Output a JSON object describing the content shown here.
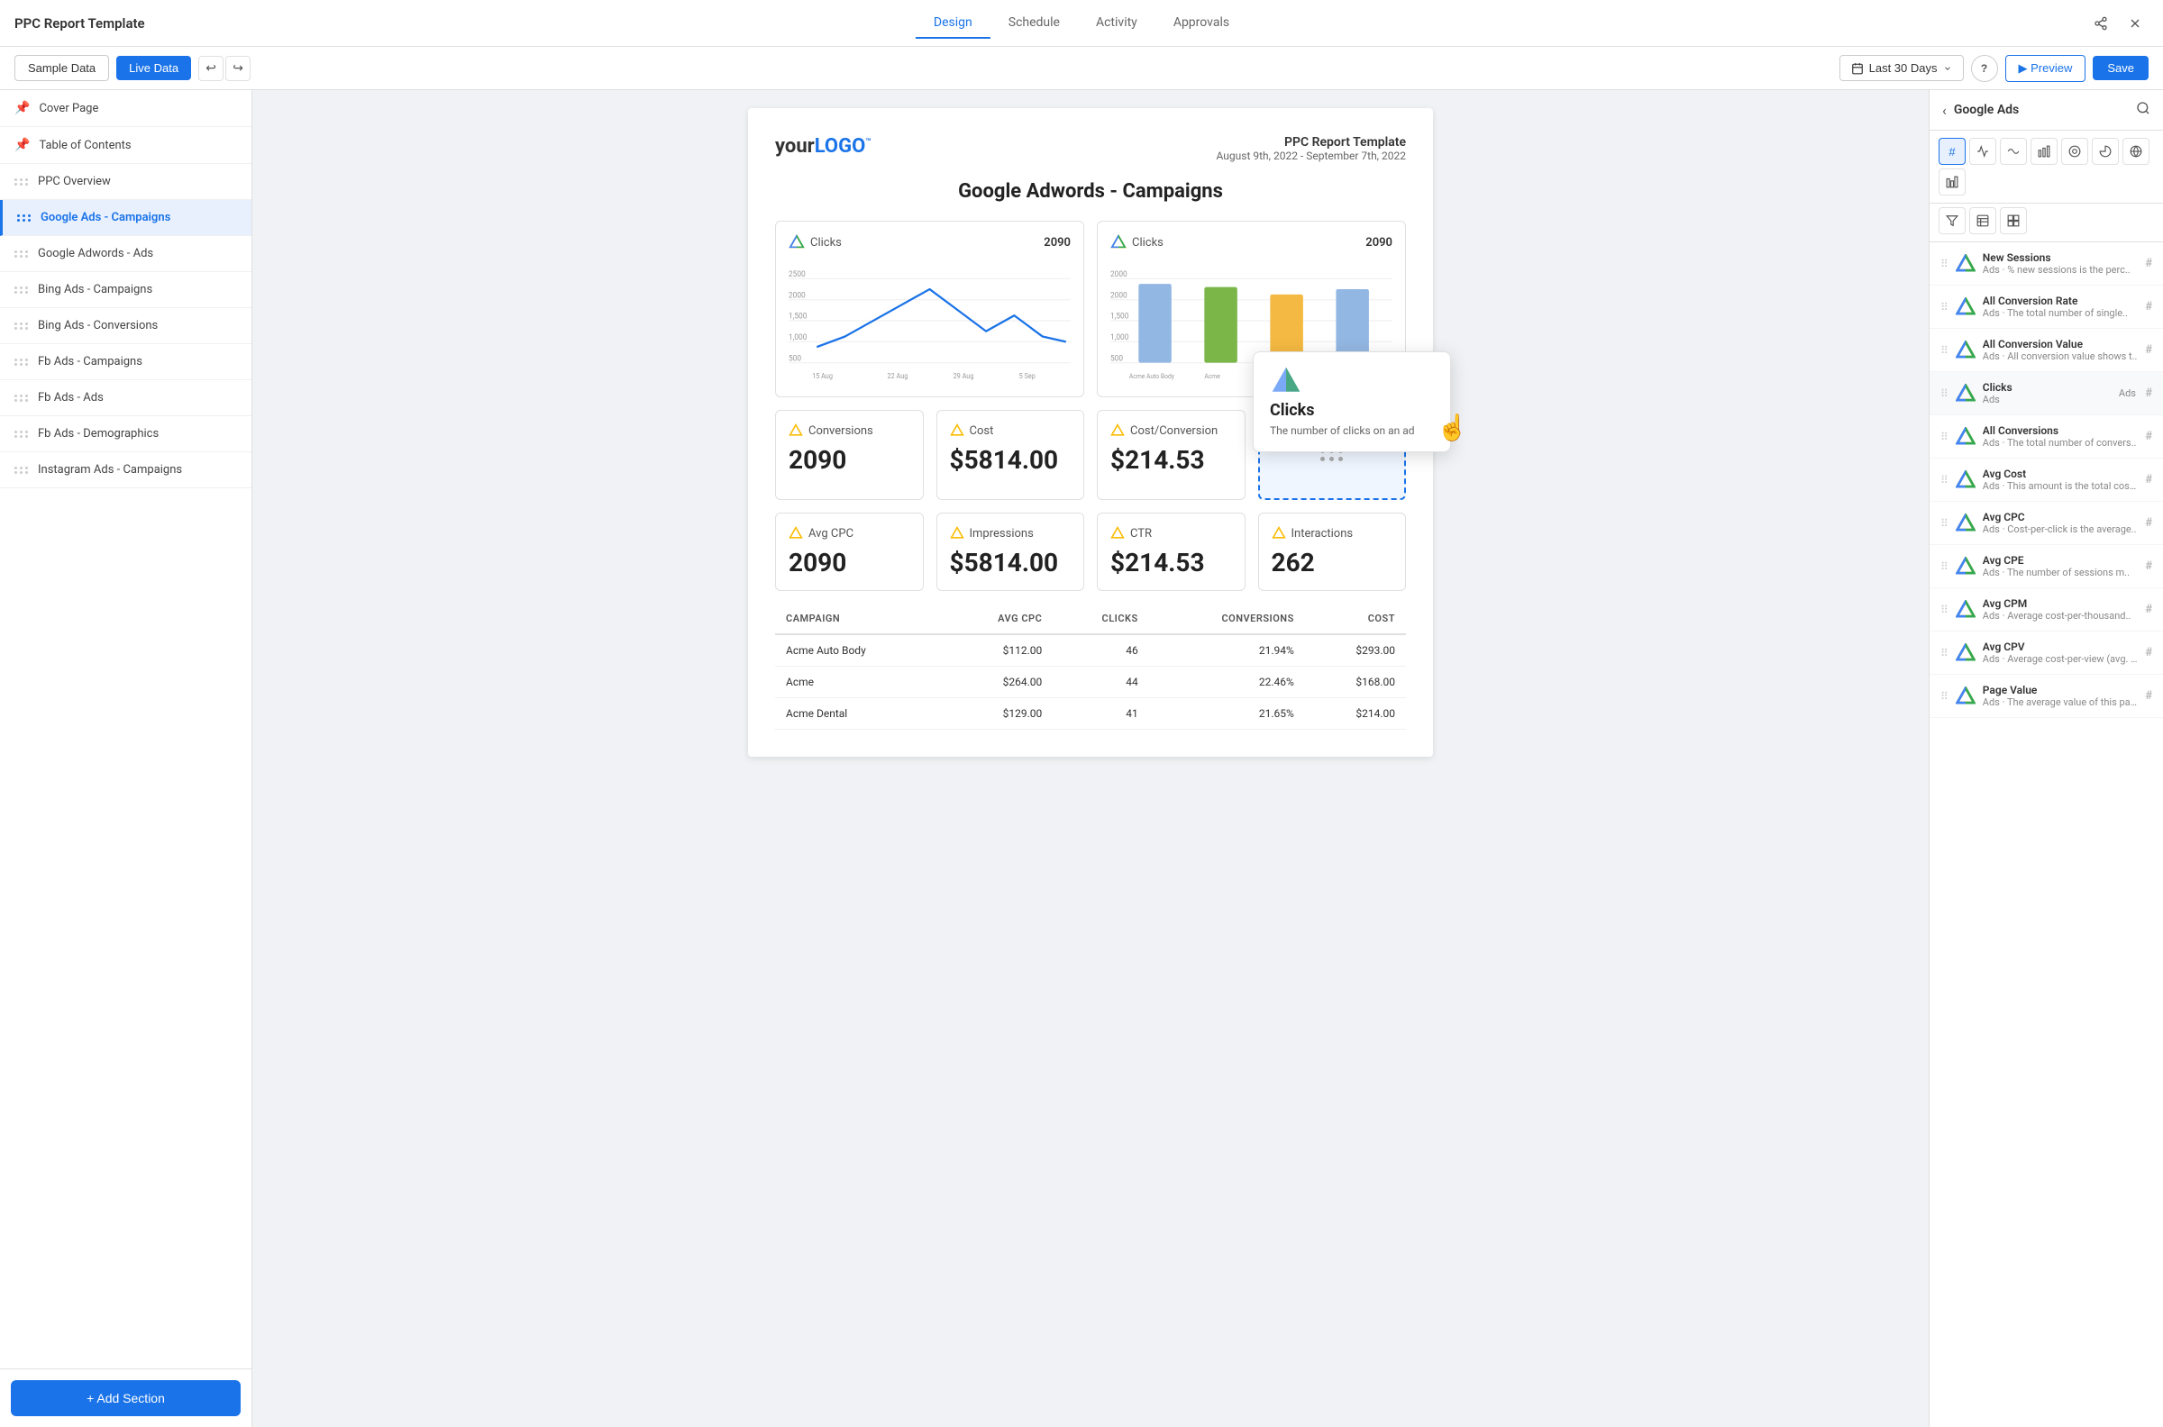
{
  "app": {
    "title": "PPC Report Template",
    "tabs": [
      "Design",
      "Schedule",
      "Activity",
      "Approvals"
    ],
    "active_tab": "Design"
  },
  "toolbar": {
    "sample_data": "Sample Data",
    "live_data": "Live Data",
    "date_range": "Last 30 Days",
    "preview": "▶ Preview",
    "save": "Save",
    "help": "?"
  },
  "sidebar": {
    "items": [
      {
        "id": "cover-page",
        "label": "Cover Page",
        "pinned": true
      },
      {
        "id": "table-of-contents",
        "label": "Table of Contents",
        "pinned": true
      },
      {
        "id": "ppc-overview",
        "label": "PPC Overview",
        "pinned": false
      },
      {
        "id": "google-ads-campaigns",
        "label": "Google Ads - Campaigns",
        "pinned": false,
        "active": true
      },
      {
        "id": "google-adwords-ads",
        "label": "Google Adwords - Ads",
        "pinned": false
      },
      {
        "id": "bing-ads-campaigns",
        "label": "Bing Ads - Campaigns",
        "pinned": false
      },
      {
        "id": "bing-ads-conversions",
        "label": "Bing Ads - Conversions",
        "pinned": false
      },
      {
        "id": "fb-ads-campaigns",
        "label": "Fb Ads - Campaigns",
        "pinned": false
      },
      {
        "id": "fb-ads-ads",
        "label": "Fb Ads - Ads",
        "pinned": false
      },
      {
        "id": "fb-ads-demographics",
        "label": "Fb Ads - Demographics",
        "pinned": false
      },
      {
        "id": "instagram-ads-campaigns",
        "label": "Instagram Ads - Campaigns",
        "pinned": false
      }
    ],
    "add_section": "+ Add Section"
  },
  "report": {
    "logo": "yourLOGO",
    "logo_tm": "™",
    "title": "Google Adwords - Campaigns",
    "report_name": "PPC Report Template",
    "date_range": "August 9th, 2022 - September 7th, 2022",
    "charts": {
      "clicks_line": {
        "label": "Clicks",
        "value": "2090"
      },
      "clicks_bar": {
        "label": "Clicks",
        "value": "2090"
      }
    },
    "stats": [
      {
        "label": "Conversions",
        "value": "2090"
      },
      {
        "label": "Cost",
        "value": "$5814.00"
      },
      {
        "label": "Cost/Conversion",
        "value": "$214.53"
      }
    ],
    "stats2": [
      {
        "label": "Avg CPC",
        "value": "2090"
      },
      {
        "label": "Impressions",
        "value": "$5814.00"
      },
      {
        "label": "CTR",
        "value": "$214.53"
      },
      {
        "label": "Interactions",
        "value": "262"
      }
    ],
    "table": {
      "headers": [
        "Campaign",
        "Avg CPC",
        "Clicks",
        "Conversions",
        "Cost"
      ],
      "rows": [
        [
          "Acme Auto Body",
          "$112.00",
          "46",
          "21.94%",
          "$293.00"
        ],
        [
          "Acme",
          "$264.00",
          "44",
          "22.46%",
          "$168.00"
        ],
        [
          "Acme Dental",
          "$129.00",
          "41",
          "21.65%",
          "$214.00"
        ],
        [
          "...",
          "...",
          "...",
          "...",
          "..."
        ]
      ]
    }
  },
  "right_panel": {
    "title": "Google Ads",
    "icon_tabs": [
      "#",
      "line",
      "curve",
      "bar",
      "donut",
      "pie",
      "geo",
      "column"
    ],
    "filter_tabs": [
      "filter",
      "table",
      "grid"
    ],
    "items": [
      {
        "name": "New Sessions",
        "source": "Ads",
        "desc": "% new sessions is the perc.."
      },
      {
        "name": "All Conversion Rate",
        "source": "Ads",
        "desc": "The total number of single.."
      },
      {
        "name": "All Conversion Value",
        "source": "Ads",
        "desc": "All conversion value shows t.."
      },
      {
        "name": "Clicks",
        "source": "Ads",
        "desc": "The number of clicks on an ad"
      },
      {
        "name": "All Conversions",
        "source": "Ads",
        "desc": "The total number of convers.."
      },
      {
        "name": "Avg Cost",
        "source": "Ads",
        "desc": "This amount is the total cost.."
      },
      {
        "name": "Avg CPC",
        "source": "Ads",
        "desc": "Cost-per-click is the average.."
      },
      {
        "name": "Avg CPE",
        "source": "Ads",
        "desc": "The number of sessions m.."
      },
      {
        "name": "Avg CPM",
        "source": "Ads",
        "desc": "Average cost-per-thousand.."
      },
      {
        "name": "Avg CPV",
        "source": "Ads",
        "desc": "Average cost-per-view (avg. CP.."
      },
      {
        "name": "Page Value",
        "source": "Ads",
        "desc": "The average value of this pag.."
      }
    ]
  },
  "tooltip": {
    "title": "Clicks",
    "desc": "The number of clicks on an ad"
  }
}
